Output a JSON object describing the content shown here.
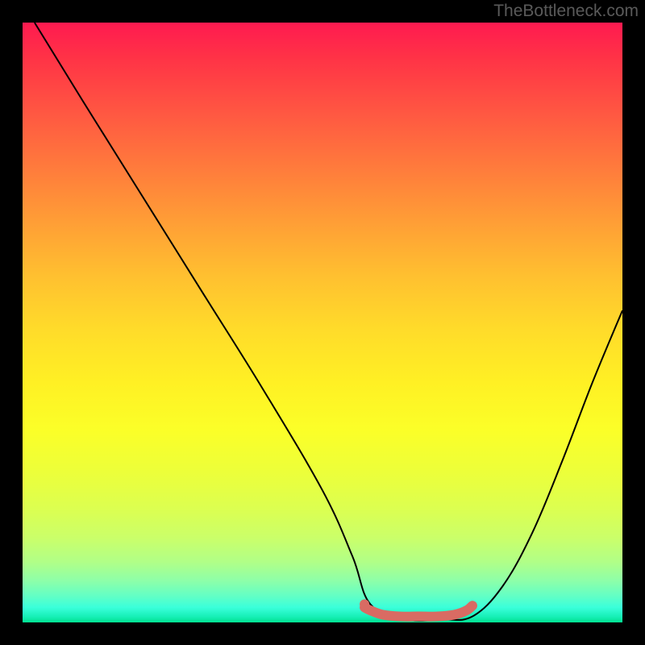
{
  "attribution": "TheBottleneck.com",
  "chart_data": {
    "type": "line",
    "title": "",
    "xlabel": "",
    "ylabel": "",
    "x_range": [
      0,
      100
    ],
    "y_range": [
      0,
      100
    ],
    "series": [
      {
        "name": "bottleneck-curve",
        "x": [
          2,
          10,
          20,
          30,
          40,
          50,
          55,
          58,
          64,
          70,
          75,
          80,
          85,
          90,
          95,
          100
        ],
        "y": [
          100,
          87,
          71,
          55,
          39,
          22,
          11,
          3,
          0.5,
          0.5,
          1,
          6,
          15,
          27,
          40,
          52
        ]
      },
      {
        "name": "optimal-range-marker",
        "x": [
          57,
          58,
          60,
          63,
          66,
          69,
          72,
          74,
          75
        ],
        "y": [
          2.5,
          2.0,
          1.3,
          1.0,
          1.0,
          1.0,
          1.3,
          2.0,
          2.8
        ]
      }
    ],
    "optimal_marker_color": "#d96b63",
    "curve_color": "#000000",
    "annotations": []
  }
}
